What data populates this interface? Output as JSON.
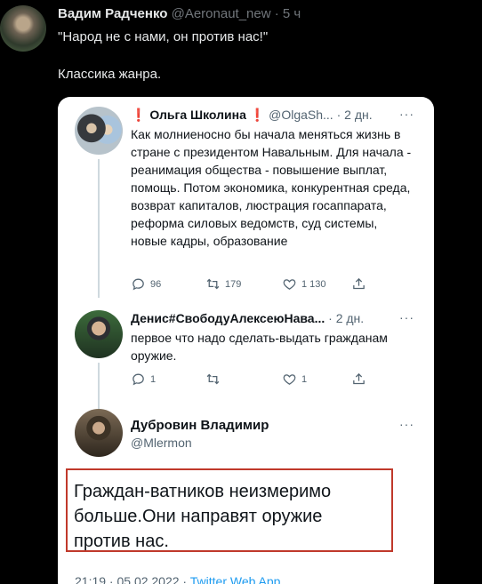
{
  "outer_tweet": {
    "author_name": "Вадим Радченко",
    "handle": "@Aeronaut_new",
    "separator": "·",
    "time": "5 ч",
    "text_line1": "\"Народ не с нами, он против нас!\"",
    "text_line2": "Классика жанра."
  },
  "screenshot": {
    "tweet1": {
      "prefix_mark": "❗",
      "author_name": "Ольга Школина",
      "suffix_mark": "❗",
      "handle": "@OlgaSh...",
      "separator": "·",
      "time": "2 дн.",
      "more": "···",
      "text": "Как молниеносно бы начала меняться жизнь в стране с президентом Навальным. Для начала - реанимация общества - повышение выплат, помощь. Потом экономика, конкурентная среда, возврат капиталов, люстрация госаппарата, реформа силовых ведомств, суд системы, новые кадры, образование",
      "replies": "96",
      "retweets": "179",
      "likes": "1 130"
    },
    "tweet2": {
      "author_name": "Денис#СвободуАлексеюНава...",
      "separator": "·",
      "time": "2 дн.",
      "more": "···",
      "text": "первое что надо сделать-выдать гражданам оружие.",
      "replies": "1",
      "retweets": "",
      "likes": "1"
    },
    "tweet3": {
      "author_name": "Дубровин Владимир",
      "handle": "@Mlermon",
      "more": "···",
      "text": "Граждан-ватников неизмеримо больше.Они направят оружие против нас.",
      "time_line": "21:19 · 05.02.2022 ·",
      "app": "Twitter Web App"
    }
  },
  "icons": {
    "reply": "reply-icon",
    "retweet": "retweet-icon",
    "like": "like-icon",
    "share": "share-icon"
  },
  "colors": {
    "background": "#000000",
    "text_primary": "#e7e9ea",
    "text_secondary": "#71767b",
    "card_bg": "#ffffff",
    "link": "#1d9bf0",
    "highlight_border": "#c0392b"
  }
}
